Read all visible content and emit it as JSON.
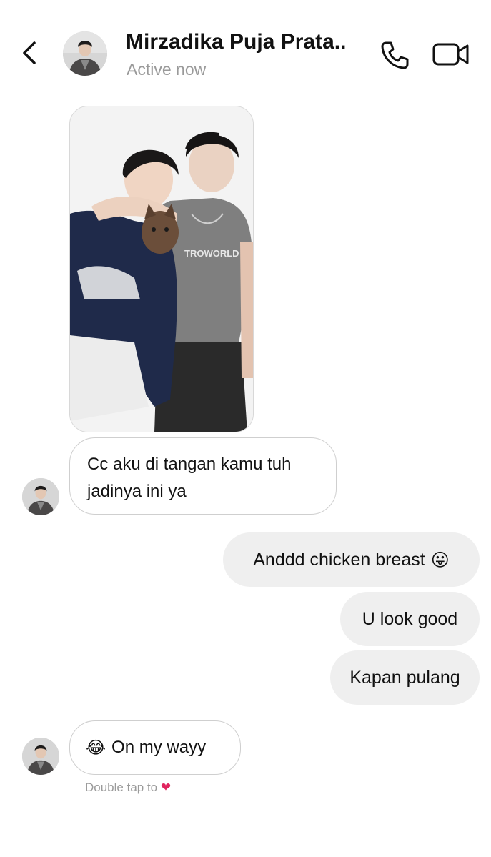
{
  "header": {
    "contact_name": "Mirzadika Puja Prata..",
    "status": "Active now",
    "back_icon": "chevron-left-icon",
    "call_icon": "phone-icon",
    "video_icon": "video-camera-icon"
  },
  "messages": [
    {
      "from": "them",
      "type": "photo"
    },
    {
      "from": "them",
      "text_line1": "Cc aku di tangan kamu tuh",
      "text_line2": "jadinya ini ya"
    },
    {
      "from": "me",
      "text": "Anddd chicken breast",
      "emoji": "😛"
    },
    {
      "from": "me",
      "text": "U look good"
    },
    {
      "from": "me",
      "text": "Kapan pulang"
    },
    {
      "from": "them",
      "emoji": "😂",
      "text": "On my wayy"
    }
  ],
  "hint": {
    "text": "Double tap to",
    "heart": "❤"
  },
  "colors": {
    "outgoing_bubble": "#efefef",
    "incoming_border": "#cfcfcf",
    "status_gray": "#9a9a9a",
    "heart": "#e0245e"
  }
}
